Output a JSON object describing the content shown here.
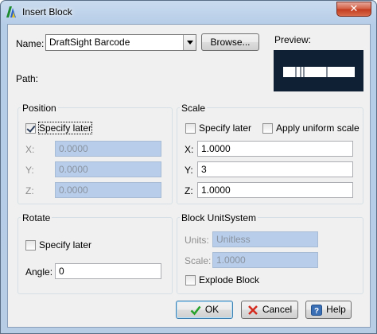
{
  "window": {
    "title": "Insert Block",
    "close_glyph": "✕"
  },
  "name_field": {
    "label": "Name:",
    "value": "DraftSight Barcode"
  },
  "browse_button": "Browse...",
  "preview_label": "Preview:",
  "path_label": "Path:",
  "position": {
    "title": "Position",
    "specify_later": {
      "label": "Specify later",
      "checked": true
    },
    "x": {
      "label": "X:",
      "value": "0.0000"
    },
    "y": {
      "label": "Y:",
      "value": "0.0000"
    },
    "z": {
      "label": "Z:",
      "value": "0.0000"
    }
  },
  "scale": {
    "title": "Scale",
    "specify_later": {
      "label": "Specify later",
      "checked": false
    },
    "apply_uniform": {
      "label": "Apply uniform scale",
      "checked": false
    },
    "x": {
      "label": "X:",
      "value": "1.0000"
    },
    "y": {
      "label": "Y:",
      "value": "3"
    },
    "z": {
      "label": "Z:",
      "value": "1.0000"
    }
  },
  "rotate": {
    "title": "Rotate",
    "specify_later": {
      "label": "Specify later",
      "checked": false
    },
    "angle": {
      "label": "Angle:",
      "value": "0"
    }
  },
  "block_unit_system": {
    "title": "Block UnitSystem",
    "units": {
      "label": "Units:",
      "value": "Unitless"
    },
    "scale": {
      "label": "Scale:",
      "value": "1.0000"
    },
    "explode": {
      "label": "Explode Block",
      "checked": false
    }
  },
  "buttons": {
    "ok": "OK",
    "cancel": "Cancel",
    "help": "Help"
  },
  "icons": {
    "app": "draftsight-logo-icon",
    "ok": "green-checkmark-icon",
    "cancel": "red-x-icon",
    "help": "question-mark-icon"
  },
  "colors": {
    "preview_bg": "#0f2035",
    "disabled_field": "#b7cde9"
  }
}
